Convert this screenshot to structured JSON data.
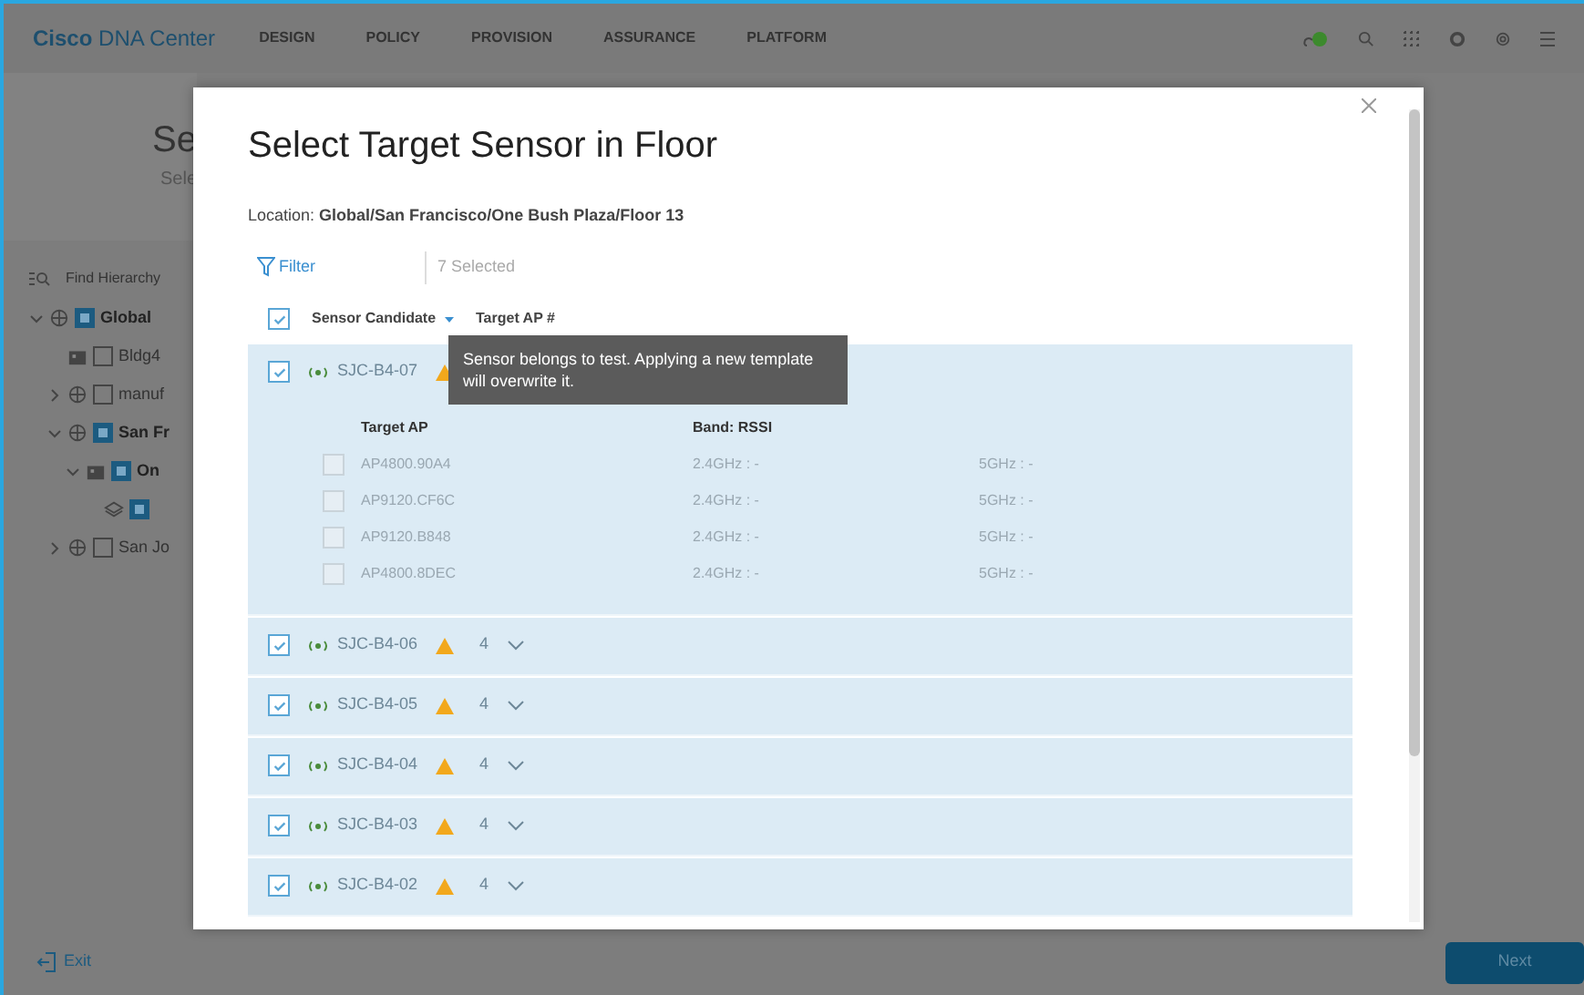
{
  "app_bar": {
    "brand_bold": "Cisco",
    "brand_light": "DNA Center",
    "nav": [
      "DESIGN",
      "POLICY",
      "PROVISION",
      "ASSURANCE",
      "PLATFORM"
    ]
  },
  "background": {
    "heading": "Se",
    "subheading": "Sele",
    "search": {
      "placeholder": "Find Hierarchy"
    },
    "tree": [
      {
        "label": "Global",
        "kind": "site",
        "expanded": true,
        "checked": true,
        "children": [
          {
            "label": "Bldg4",
            "kind": "building",
            "checked": false
          },
          {
            "label": "manuf",
            "kind": "site",
            "expanded": false,
            "checked": false
          },
          {
            "label": "San Fr",
            "kind": "site",
            "expanded": true,
            "checked": true,
            "children": [
              {
                "label": "On",
                "kind": "building",
                "expanded": true,
                "checked": true,
                "children": [
                  {
                    "kind": "floor",
                    "checked": true
                  }
                ]
              }
            ]
          },
          {
            "label": "San Jo",
            "kind": "site",
            "expanded": false,
            "checked": false
          }
        ]
      }
    ],
    "exit": "Exit",
    "next": "Next"
  },
  "dialog": {
    "title": "Select Target Sensor in Floor",
    "location_label": "Location:",
    "location": "Global/San Francisco/One Bush Plaza/Floor 13",
    "filter": "Filter",
    "selected_count": "7 Selected",
    "columns": [
      "Sensor Candidate",
      "Target AP #"
    ],
    "all_checked": true,
    "tooltip": "Sensor belongs to test. Applying a new template will overwrite it.",
    "sensors": [
      {
        "name": "SJC-B4-07",
        "checked": true,
        "warning": true,
        "expanded": true,
        "ap_columns": [
          "Target AP",
          "Band: RSSI"
        ],
        "target_aps": [
          {
            "name": "AP4800.90A4",
            "checked": false,
            "band_24": "2.4GHz : -",
            "band_5": "5GHz : -"
          },
          {
            "name": "AP9120.CF6C",
            "checked": false,
            "band_24": "2.4GHz : -",
            "band_5": "5GHz : -"
          },
          {
            "name": "AP9120.B848",
            "checked": false,
            "band_24": "2.4GHz : -",
            "band_5": "5GHz : -"
          },
          {
            "name": "AP4800.8DEC",
            "checked": false,
            "band_24": "2.4GHz : -",
            "band_5": "5GHz : -"
          }
        ]
      },
      {
        "name": "SJC-B4-06",
        "checked": true,
        "warning": true,
        "expanded": false,
        "ap_count": "4"
      },
      {
        "name": "SJC-B4-05",
        "checked": true,
        "warning": true,
        "expanded": false,
        "ap_count": "4"
      },
      {
        "name": "SJC-B4-04",
        "checked": true,
        "warning": true,
        "expanded": false,
        "ap_count": "4"
      },
      {
        "name": "SJC-B4-03",
        "checked": true,
        "warning": true,
        "expanded": false,
        "ap_count": "4"
      },
      {
        "name": "SJC-B4-02",
        "checked": true,
        "warning": true,
        "expanded": false,
        "ap_count": "4"
      }
    ]
  }
}
